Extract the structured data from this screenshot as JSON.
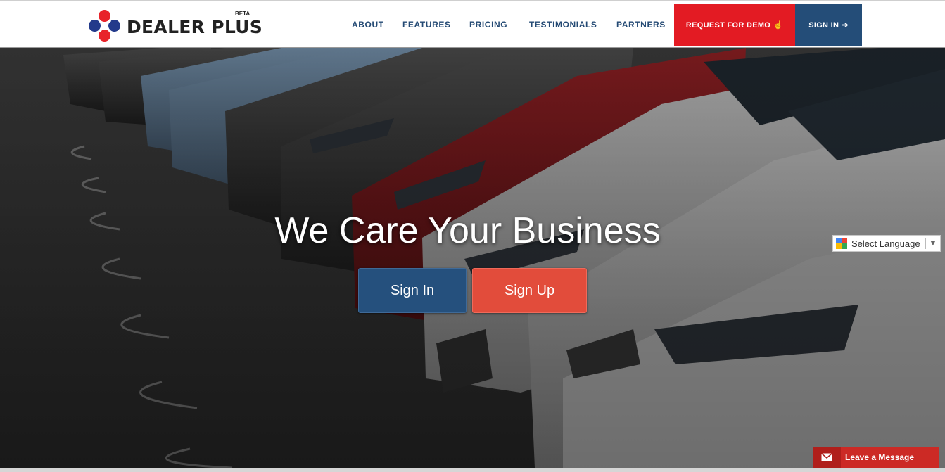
{
  "brand": {
    "name": "DEALER PLUS",
    "badge": "BETA"
  },
  "nav": {
    "items": [
      "ABOUT",
      "FEATURES",
      "PRICING",
      "TESTIMONIALS",
      "PARTNERS"
    ],
    "demo_label": "REQUEST FOR DEMO",
    "signin_label": "SIGN IN"
  },
  "hero": {
    "headline": "We Care Your Business",
    "signin_label": "Sign In",
    "signup_label": "Sign Up"
  },
  "language": {
    "label": "Select Language",
    "arrow": "▼"
  },
  "chat": {
    "label": "Leave a Message"
  },
  "icons": {
    "demo": "pointer-hand-icon",
    "signin": "sign-in-icon",
    "language": "google-translate-icon",
    "chat": "envelope-icon"
  },
  "colors": {
    "nav_text": "#244a74",
    "demo_bg": "#e31b23",
    "signin_bg": "#244d78",
    "cta_signin": "#25507d",
    "cta_signup": "#e24c3b",
    "chat_bg": "#cc2a25"
  }
}
